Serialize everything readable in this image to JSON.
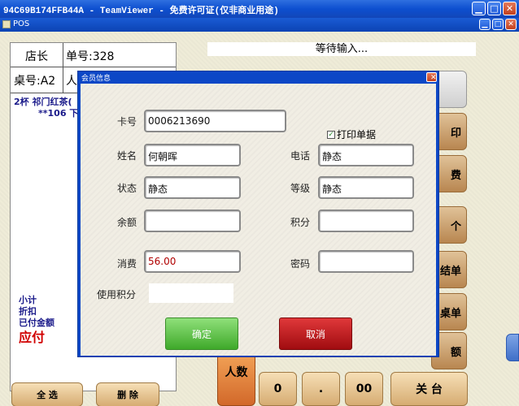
{
  "teamviewer": {
    "title": "94C69B174FFB44A - TeamViewer - 免费许可证(仅非商业用途)"
  },
  "pos_window": {
    "title": "POS"
  },
  "order": {
    "shop_manager": "店长",
    "order_no": "单号:328",
    "table_no": "桌号:A2",
    "people_partial": "人",
    "item_line1": "2杯    祁门红茶(",
    "item_line2": "**106 下",
    "subtotal_label": "小计",
    "discount_label": "折扣",
    "paid_label": "已付金额",
    "due_label": "应付"
  },
  "status_text": "等待输入...",
  "right_buttons": {
    "b2": "印",
    "b3": "费",
    "b4": "个",
    "b5": "结单",
    "b6": "桌单",
    "b7": "额"
  },
  "bottom_buttons": {
    "select_all": "全 选",
    "delete": "删 除",
    "people": "人数",
    "zero": "0",
    "dot": ".",
    "double_zero": "00",
    "close_table": "关  台"
  },
  "dialog": {
    "title": "会员信息",
    "card_label": "卡号",
    "card_value": "0006213690",
    "print_receipt": "打印单据",
    "name_label": "姓名",
    "name_value": "何朝晖",
    "phone_label": "电话",
    "phone_value": "静态",
    "state_label": "状态",
    "state_value": "静态",
    "level_label": "等级",
    "level_value": "静态",
    "balance_label": "余额",
    "points_label": "积分",
    "consume_label": "消费",
    "consume_value": "56.00",
    "password_label": "密码",
    "use_points_label": "使用积分",
    "ok": "确定",
    "cancel": "取消"
  }
}
